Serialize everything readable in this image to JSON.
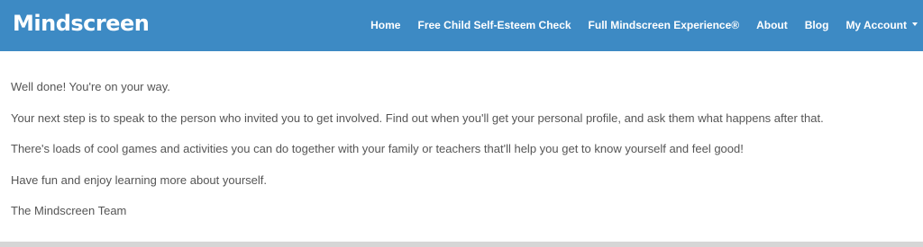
{
  "header": {
    "logo": "Mindscreen",
    "nav": [
      {
        "label": "Home"
      },
      {
        "label": "Free Child Self-Esteem Check"
      },
      {
        "label": "Full Mindscreen Experience®"
      },
      {
        "label": "About"
      },
      {
        "label": "Blog"
      },
      {
        "label": "My Account"
      }
    ],
    "colors": {
      "bar": "#3d8ac4",
      "text": "#ffffff"
    }
  },
  "main": {
    "paragraphs": [
      "Well done! You're on your way.",
      "Your next step is to speak to the person who invited you to get involved. Find out when you'll get your personal profile, and ask them what happens after that.",
      "There's loads of cool games and activities you can do together with your family or teachers that'll help you get to know yourself and feel good!",
      "Have fun and enjoy learning more about yourself.",
      "The Mindscreen Team"
    ]
  }
}
